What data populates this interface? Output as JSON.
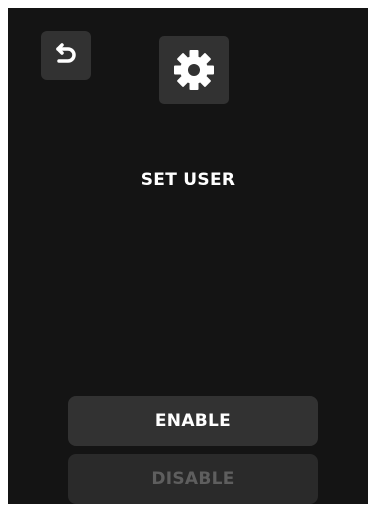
{
  "header": {
    "back_icon": "back-arrow-icon",
    "settings_icon": "gear-icon"
  },
  "main": {
    "title": "SET USER"
  },
  "actions": {
    "enable_label": "ENABLE",
    "disable_label": "DISABLE"
  },
  "colors": {
    "background": "#141414",
    "tile": "#323232",
    "text_primary": "#ffffff",
    "text_disabled": "#5e5e5e"
  }
}
